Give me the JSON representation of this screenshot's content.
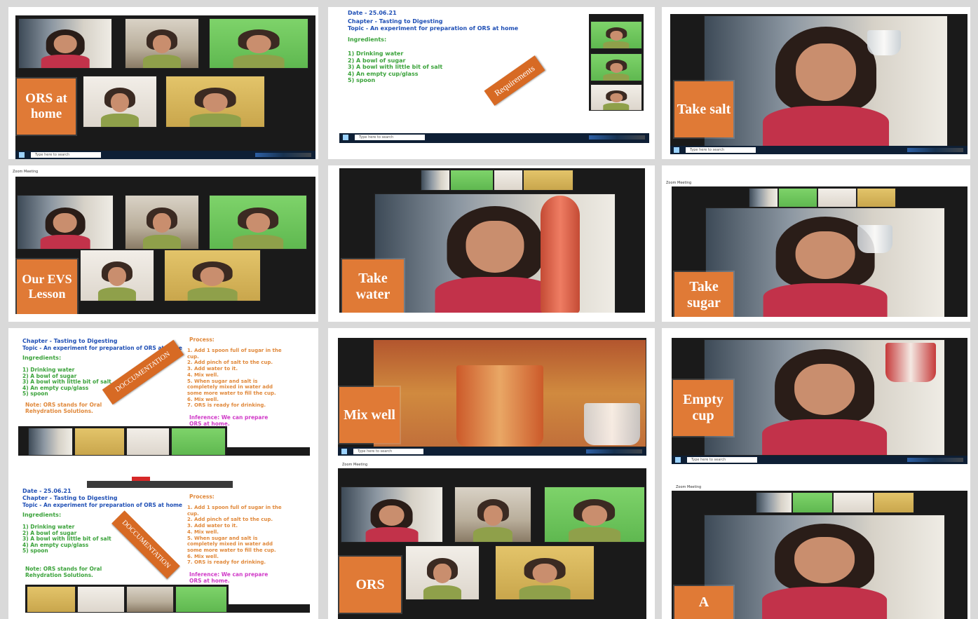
{
  "labels": {
    "ors_at_home": "ORS at home",
    "our_evs_lesson": "Our EVS Lesson",
    "take_salt": "Take salt",
    "take_water": "Take water",
    "take_sugar": "Take sugar",
    "mix_well": "Mix well",
    "empty_cup": "Empty cup",
    "ors": "ORS",
    "a": "A"
  },
  "slide": {
    "date": "Date - 25.06.21",
    "chapter": "Chapter - Tasting to Digesting",
    "topic": "Topic - An experiment for preparation of ORS at home",
    "ingredients_title": "Ingredients:",
    "ingredients": "1) Drinking water\n2) A bowl of sugar\n3) A bowl with little bit of salt\n4) An empty cup/glass\n5) spoon",
    "requirements_stamp": "Requirements",
    "documentation_stamp": "DOCCUMENTATION",
    "note": "Note: ORS stands for Oral\nRehydration Solutions.",
    "process_title": "Process:",
    "process_steps": "1. Add 1 spoon full of sugar in the\ncup.\n2. Add pinch of salt to the cup.\n3. Add water to it.\n4. Mix well.\n5. When sugar and salt is\ncompletely mixed in water add\nsome more water to fill the cup.\n6. Mix well.\n7. ORS is ready for drinking.",
    "inference": "Inference: We can prepare\nORS at home."
  },
  "ui": {
    "taskbar_search": "Type here to search",
    "zoom_title": "Zoom Meeting"
  },
  "colors": {
    "label_box": "#e07a36",
    "slide_blue": "#1f4fb5",
    "slide_green": "#3aa23a",
    "slide_orange": "#e0883a",
    "slide_magenta": "#d03ac8",
    "taskbar": "#0e1f35"
  }
}
